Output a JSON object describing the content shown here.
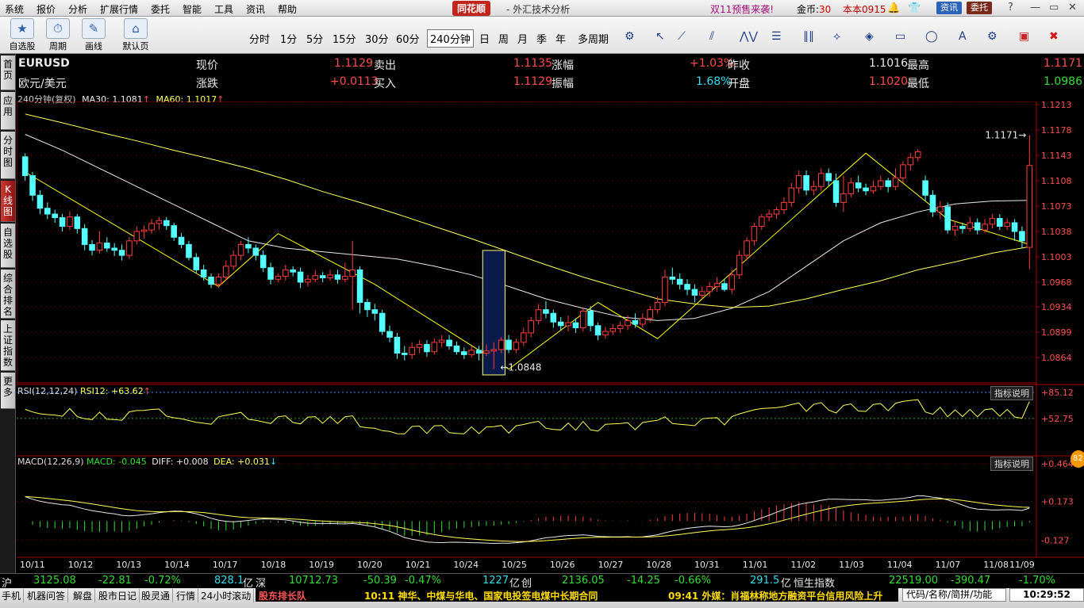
{
  "menu": [
    "系统",
    "报价",
    "分析",
    "扩展行情",
    "委托",
    "智能",
    "工具",
    "资讯",
    "帮助"
  ],
  "brand": "同花顺",
  "app_title": "- 外汇技术分析",
  "promo": "双11预售来袭!",
  "coins_label": "金币:",
  "coins_value": "30",
  "account": "本本0915",
  "header_btns": {
    "news": "资讯",
    "trade": "委托"
  },
  "toolbar": {
    "buttons": [
      "自选股",
      "周期",
      "画线",
      "默认页"
    ],
    "periods": [
      "分时",
      "1分",
      "5分",
      "15分",
      "30分",
      "60分",
      "240分钟",
      "日",
      "周",
      "月",
      "季",
      "年",
      "多周期"
    ],
    "active_period": "240分钟"
  },
  "left_tabs": [
    "首页",
    "应用",
    "分时图",
    "K线图",
    "自选股",
    "综合排名",
    "上证指数",
    "更多"
  ],
  "quote": {
    "symbol": "EURUSD",
    "name": "欧元/美元",
    "labels": {
      "now": "现价",
      "change": "涨跌",
      "sell": "卖出",
      "buy": "买入",
      "pct": "涨幅",
      "amp": "振幅",
      "prev": "昨收",
      "open": "开盘",
      "high": "最高",
      "low": "最低"
    },
    "now": "1.1129",
    "change": "+0.0113",
    "sell": "1.1135",
    "buy": "1.1129",
    "pct": "+1.03%",
    "amp": "1.68%",
    "prev": "1.1016",
    "open": "1.1020",
    "high": "1.1171",
    "low": "1.0986"
  },
  "ma_legend": {
    "period": "240分钟(复权)",
    "ma30_label": "MA30:",
    "ma30": "1.1081",
    "ma60_label": "MA60:",
    "ma60": "1.1017"
  },
  "chart_data": {
    "type": "candlestick",
    "price_axis": [
      "1.1213",
      "1.1178",
      "1.1143",
      "1.1108",
      "1.1073",
      "1.1038",
      "1.1003",
      "1.0968",
      "1.0934",
      "1.0899",
      "1.0864"
    ],
    "ylim": [
      1.0829,
      1.1213
    ],
    "dates": [
      "10/11",
      "10/12",
      "10/13",
      "10/14",
      "10/17",
      "10/18",
      "10/19",
      "10/20",
      "10/21",
      "10/24",
      "10/25",
      "10/26",
      "10/27",
      "10/28",
      "10/31",
      "11/01",
      "11/02",
      "11/03",
      "11/04",
      "11/07",
      "11/08",
      "11/09"
    ],
    "annotations": {
      "low_label": "1.0848",
      "high_label": "1.1171"
    },
    "candles": [
      {
        "o": 1.1141,
        "c": 1.1115,
        "h": 1.1146,
        "l": 1.1108
      },
      {
        "o": 1.1115,
        "c": 1.1088,
        "h": 1.112,
        "l": 1.108
      },
      {
        "o": 1.1088,
        "c": 1.107,
        "h": 1.1095,
        "l": 1.1062
      },
      {
        "o": 1.107,
        "c": 1.1062,
        "h": 1.1078,
        "l": 1.1055
      },
      {
        "o": 1.1062,
        "c": 1.1057,
        "h": 1.1068,
        "l": 1.105
      },
      {
        "o": 1.1057,
        "c": 1.1045,
        "h": 1.1062,
        "l": 1.1038
      },
      {
        "o": 1.1045,
        "c": 1.1058,
        "h": 1.1066,
        "l": 1.104
      },
      {
        "o": 1.1058,
        "c": 1.1042,
        "h": 1.1062,
        "l": 1.1035
      },
      {
        "o": 1.1042,
        "c": 1.102,
        "h": 1.1048,
        "l": 1.1012
      },
      {
        "o": 1.102,
        "c": 1.1012,
        "h": 1.1026,
        "l": 1.1005
      },
      {
        "o": 1.1012,
        "c": 1.1022,
        "h": 1.1038,
        "l": 1.1008
      },
      {
        "o": 1.1022,
        "c": 1.1015,
        "h": 1.103,
        "l": 1.101
      },
      {
        "o": 1.1015,
        "c": 1.1012,
        "h": 1.1022,
        "l": 1.1004
      },
      {
        "o": 1.1012,
        "c": 1.1005,
        "h": 1.102,
        "l": 1.0998
      },
      {
        "o": 1.1005,
        "c": 1.1025,
        "h": 1.103,
        "l": 1.1
      },
      {
        "o": 1.1025,
        "c": 1.1038,
        "h": 1.1045,
        "l": 1.102
      },
      {
        "o": 1.1038,
        "c": 1.104,
        "h": 1.1046,
        "l": 1.1028
      },
      {
        "o": 1.104,
        "c": 1.1049,
        "h": 1.1055,
        "l": 1.1035
      },
      {
        "o": 1.1049,
        "c": 1.1053,
        "h": 1.1058,
        "l": 1.104
      },
      {
        "o": 1.1053,
        "c": 1.1046,
        "h": 1.1058,
        "l": 1.104
      },
      {
        "o": 1.1046,
        "c": 1.103,
        "h": 1.105,
        "l": 1.1025
      },
      {
        "o": 1.103,
        "c": 1.102,
        "h": 1.1036,
        "l": 1.1015
      },
      {
        "o": 1.102,
        "c": 1.1002,
        "h": 1.1025,
        "l": 1.0998
      },
      {
        "o": 1.1002,
        "c": 1.0985,
        "h": 1.1008,
        "l": 1.098
      },
      {
        "o": 1.0985,
        "c": 1.0975,
        "h": 1.0992,
        "l": 1.097
      },
      {
        "o": 1.0975,
        "c": 1.0965,
        "h": 1.098,
        "l": 1.096
      },
      {
        "o": 1.0965,
        "c": 1.0975,
        "h": 1.098,
        "l": 1.096
      },
      {
        "o": 1.0975,
        "c": 1.099,
        "h": 1.0998,
        "l": 1.097
      },
      {
        "o": 1.099,
        "c": 1.1005,
        "h": 1.1012,
        "l": 1.0985
      },
      {
        "o": 1.1005,
        "c": 1.102,
        "h": 1.1025,
        "l": 1.0998
      },
      {
        "o": 1.102,
        "c": 1.1015,
        "h": 1.103,
        "l": 1.1008
      },
      {
        "o": 1.1015,
        "c": 1.1005,
        "h": 1.102,
        "l": 1.0998
      },
      {
        "o": 1.1005,
        "c": 1.0988,
        "h": 1.1012,
        "l": 1.0982
      },
      {
        "o": 1.0988,
        "c": 1.0972,
        "h": 1.0995,
        "l": 1.0965
      },
      {
        "o": 1.0972,
        "c": 1.0976,
        "h": 1.098,
        "l": 1.0968
      },
      {
        "o": 1.0976,
        "c": 1.0985,
        "h": 1.0992,
        "l": 1.097
      },
      {
        "o": 1.0985,
        "c": 1.0982,
        "h": 1.099,
        "l": 1.0976
      },
      {
        "o": 1.0982,
        "c": 1.0968,
        "h": 1.0988,
        "l": 1.096
      },
      {
        "o": 1.0968,
        "c": 1.0972,
        "h": 1.0978,
        "l": 1.0962
      },
      {
        "o": 1.0972,
        "c": 1.0977,
        "h": 1.0985,
        "l": 1.0968
      },
      {
        "o": 1.0977,
        "c": 1.0974,
        "h": 1.0982,
        "l": 1.0968
      },
      {
        "o": 1.0974,
        "c": 1.0978,
        "h": 1.0985,
        "l": 1.097
      },
      {
        "o": 1.0978,
        "c": 1.0972,
        "h": 1.0985,
        "l": 1.0966
      },
      {
        "o": 1.0972,
        "c": 1.0976,
        "h": 1.0995,
        "l": 1.0968
      },
      {
        "o": 1.0976,
        "c": 1.0985,
        "h": 1.1025,
        "l": 1.093
      },
      {
        "o": 1.0985,
        "c": 1.094,
        "h": 1.099,
        "l": 1.0925
      },
      {
        "o": 1.094,
        "c": 1.093,
        "h": 1.0945,
        "l": 1.092
      },
      {
        "o": 1.093,
        "c": 1.0925,
        "h": 1.0938,
        "l": 1.0915
      },
      {
        "o": 1.0925,
        "c": 1.09,
        "h": 1.093,
        "l": 1.0895
      },
      {
        "o": 1.09,
        "c": 1.0892,
        "h": 1.0908,
        "l": 1.0885
      },
      {
        "o": 1.0892,
        "c": 1.087,
        "h": 1.0898,
        "l": 1.0862
      },
      {
        "o": 1.087,
        "c": 1.0868,
        "h": 1.088,
        "l": 1.086
      },
      {
        "o": 1.0868,
        "c": 1.0878,
        "h": 1.0885,
        "l": 1.0862
      },
      {
        "o": 1.0878,
        "c": 1.0882,
        "h": 1.0888,
        "l": 1.087
      },
      {
        "o": 1.0882,
        "c": 1.0872,
        "h": 1.0888,
        "l": 1.0865
      },
      {
        "o": 1.0872,
        "c": 1.0885,
        "h": 1.089,
        "l": 1.0868
      },
      {
        "o": 1.0885,
        "c": 1.0888,
        "h": 1.0895,
        "l": 1.0878
      },
      {
        "o": 1.0888,
        "c": 1.088,
        "h": 1.0895,
        "l": 1.0875
      },
      {
        "o": 1.088,
        "c": 1.0872,
        "h": 1.0886,
        "l": 1.0868
      },
      {
        "o": 1.0872,
        "c": 1.0868,
        "h": 1.0878,
        "l": 1.0862
      },
      {
        "o": 1.0868,
        "c": 1.0874,
        "h": 1.088,
        "l": 1.0864
      },
      {
        "o": 1.0874,
        "c": 1.087,
        "h": 1.088,
        "l": 1.086
      },
      {
        "o": 1.087,
        "c": 1.0873,
        "h": 1.0882,
        "l": 1.0866
      },
      {
        "o": 1.0873,
        "c": 1.0875,
        "h": 1.0885,
        "l": 1.0848
      },
      {
        "o": 1.0875,
        "c": 1.0888,
        "h": 1.0892,
        "l": 1.087
      },
      {
        "o": 1.0888,
        "c": 1.0875,
        "h": 1.0895,
        "l": 1.087
      },
      {
        "o": 1.0875,
        "c": 1.0885,
        "h": 1.089,
        "l": 1.087
      },
      {
        "o": 1.0885,
        "c": 1.0898,
        "h": 1.0905,
        "l": 1.088
      },
      {
        "o": 1.0898,
        "c": 1.0915,
        "h": 1.092,
        "l": 1.0892
      },
      {
        "o": 1.0915,
        "c": 1.093,
        "h": 1.0938,
        "l": 1.091
      },
      {
        "o": 1.093,
        "c": 1.0925,
        "h": 1.0942,
        "l": 1.0918
      },
      {
        "o": 1.0925,
        "c": 1.0913,
        "h": 1.093,
        "l": 1.0905
      },
      {
        "o": 1.0913,
        "c": 1.0908,
        "h": 1.092,
        "l": 1.0902
      },
      {
        "o": 1.0908,
        "c": 1.0912,
        "h": 1.0922,
        "l": 1.09
      },
      {
        "o": 1.0912,
        "c": 1.0905,
        "h": 1.0918,
        "l": 1.0898
      },
      {
        "o": 1.0905,
        "c": 1.0928,
        "h": 1.0932,
        "l": 1.09
      },
      {
        "o": 1.0928,
        "c": 1.0908,
        "h": 1.0935,
        "l": 1.09
      },
      {
        "o": 1.0908,
        "c": 1.0895,
        "h": 1.0912,
        "l": 1.0888
      },
      {
        "o": 1.0895,
        "c": 1.09,
        "h": 1.0906,
        "l": 1.089
      },
      {
        "o": 1.09,
        "c": 1.0904,
        "h": 1.091,
        "l": 1.0895
      },
      {
        "o": 1.0904,
        "c": 1.0908,
        "h": 1.0914,
        "l": 1.0898
      },
      {
        "o": 1.0908,
        "c": 1.0915,
        "h": 1.0922,
        "l": 1.0902
      },
      {
        "o": 1.0915,
        "c": 1.091,
        "h": 1.0925,
        "l": 1.0905
      },
      {
        "o": 1.091,
        "c": 1.0918,
        "h": 1.0925,
        "l": 1.0905
      },
      {
        "o": 1.0918,
        "c": 1.093,
        "h": 1.0935,
        "l": 1.0912
      },
      {
        "o": 1.093,
        "c": 1.094,
        "h": 1.0948,
        "l": 1.0925
      },
      {
        "o": 1.094,
        "c": 1.0975,
        "h": 1.0985,
        "l": 1.0935
      },
      {
        "o": 1.0975,
        "c": 1.0972,
        "h": 1.0988,
        "l": 1.0965
      },
      {
        "o": 1.0972,
        "c": 1.0965,
        "h": 1.098,
        "l": 1.0958
      },
      {
        "o": 1.0965,
        "c": 1.0958,
        "h": 1.0972,
        "l": 1.095
      },
      {
        "o": 1.0958,
        "c": 1.095,
        "h": 1.0965,
        "l": 1.094
      },
      {
        "o": 1.095,
        "c": 1.0955,
        "h": 1.0962,
        "l": 1.0945
      },
      {
        "o": 1.0955,
        "c": 1.0962,
        "h": 1.0968,
        "l": 1.0948
      },
      {
        "o": 1.0962,
        "c": 1.0966,
        "h": 1.0975,
        "l": 1.0955
      },
      {
        "o": 1.0966,
        "c": 1.0958,
        "h": 1.0972,
        "l": 1.0955
      },
      {
        "o": 1.0958,
        "c": 1.0978,
        "h": 1.0985,
        "l": 1.0952
      },
      {
        "o": 1.0978,
        "c": 1.1005,
        "h": 1.1012,
        "l": 1.0972
      },
      {
        "o": 1.1005,
        "c": 1.1025,
        "h": 1.103,
        "l": 1.0998
      },
      {
        "o": 1.1025,
        "c": 1.1045,
        "h": 1.105,
        "l": 1.1018
      },
      {
        "o": 1.1045,
        "c": 1.1058,
        "h": 1.1062,
        "l": 1.104
      },
      {
        "o": 1.1058,
        "c": 1.1062,
        "h": 1.1068,
        "l": 1.1052
      },
      {
        "o": 1.1062,
        "c": 1.1068,
        "h": 1.1072,
        "l": 1.1055
      },
      {
        "o": 1.1068,
        "c": 1.1078,
        "h": 1.1085,
        "l": 1.1062
      },
      {
        "o": 1.1078,
        "c": 1.1098,
        "h": 1.1105,
        "l": 1.1072
      },
      {
        "o": 1.1098,
        "c": 1.1115,
        "h": 1.1122,
        "l": 1.109
      },
      {
        "o": 1.1115,
        "c": 1.1095,
        "h": 1.1122,
        "l": 1.1088
      },
      {
        "o": 1.1095,
        "c": 1.11,
        "h": 1.1108,
        "l": 1.1088
      },
      {
        "o": 1.11,
        "c": 1.1118,
        "h": 1.1125,
        "l": 1.1094
      },
      {
        "o": 1.1118,
        "c": 1.1108,
        "h": 1.1125,
        "l": 1.11
      },
      {
        "o": 1.1108,
        "c": 1.1078,
        "h": 1.1118,
        "l": 1.1072
      },
      {
        "o": 1.1078,
        "c": 1.109,
        "h": 1.1115,
        "l": 1.1065
      },
      {
        "o": 1.109,
        "c": 1.1105,
        "h": 1.1112,
        "l": 1.1085
      },
      {
        "o": 1.1105,
        "c": 1.1098,
        "h": 1.1115,
        "l": 1.1092
      },
      {
        "o": 1.1098,
        "c": 1.1094,
        "h": 1.1104,
        "l": 1.1088
      },
      {
        "o": 1.1094,
        "c": 1.11,
        "h": 1.1108,
        "l": 1.109
      },
      {
        "o": 1.11,
        "c": 1.1108,
        "h": 1.1115,
        "l": 1.1095
      },
      {
        "o": 1.1108,
        "c": 1.11,
        "h": 1.1112,
        "l": 1.1092
      },
      {
        "o": 1.11,
        "c": 1.1112,
        "h": 1.1125,
        "l": 1.1095
      },
      {
        "o": 1.1112,
        "c": 1.113,
        "h": 1.1135,
        "l": 1.1105
      },
      {
        "o": 1.113,
        "c": 1.114,
        "h": 1.1146,
        "l": 1.1122
      },
      {
        "o": 1.114,
        "c": 1.1148,
        "h": 1.1152,
        "l": 1.1135
      },
      {
        "o": 1.1108,
        "c": 1.1088,
        "h": 1.1115,
        "l": 1.108
      },
      {
        "o": 1.1088,
        "c": 1.1065,
        "h": 1.1095,
        "l": 1.1058
      },
      {
        "o": 1.1065,
        "c": 1.1072,
        "h": 1.108,
        "l": 1.1055
      },
      {
        "o": 1.1072,
        "c": 1.104,
        "h": 1.1078,
        "l": 1.1035
      },
      {
        "o": 1.104,
        "c": 1.1045,
        "h": 1.1052,
        "l": 1.1032
      },
      {
        "o": 1.1045,
        "c": 1.1042,
        "h": 1.105,
        "l": 1.1035
      },
      {
        "o": 1.1042,
        "c": 1.105,
        "h": 1.1058,
        "l": 1.1038
      },
      {
        "o": 1.105,
        "c": 1.104,
        "h": 1.1056,
        "l": 1.1034
      },
      {
        "o": 1.104,
        "c": 1.1048,
        "h": 1.1055,
        "l": 1.1036
      },
      {
        "o": 1.1048,
        "c": 1.1056,
        "h": 1.1062,
        "l": 1.1042
      },
      {
        "o": 1.1056,
        "c": 1.1045,
        "h": 1.1062,
        "l": 1.104
      },
      {
        "o": 1.1045,
        "c": 1.105,
        "h": 1.1056,
        "l": 1.104
      },
      {
        "o": 1.105,
        "c": 1.1038,
        "h": 1.1055,
        "l": 1.1025
      },
      {
        "o": 1.1038,
        "c": 1.1025,
        "h": 1.1045,
        "l": 1.1015
      },
      {
        "o": 1.1016,
        "c": 1.1129,
        "h": 1.1171,
        "l": 1.0986
      }
    ],
    "ma30": [
      1.1172,
      1.115,
      1.1125,
      1.11,
      1.1075,
      1.105,
      1.1025,
      1.1015,
      1.101,
      1.1005,
      1.1,
      1.099,
      1.0978,
      1.0962,
      1.0945,
      1.0932,
      1.092,
      1.0915,
      1.0918,
      1.0932,
      1.0955,
      1.099,
      1.1025,
      1.105,
      1.1065,
      1.1076,
      1.108,
      1.1081
    ],
    "ma60": [
      1.12,
      1.1188,
      1.1175,
      1.1163,
      1.115,
      1.1138,
      1.1125,
      1.111,
      1.1093,
      1.1078,
      1.1062,
      1.1045,
      1.1028,
      1.101,
      1.0992,
      1.0975,
      1.096,
      1.0945,
      1.0938,
      1.0933,
      1.0935,
      1.0945,
      1.0958,
      1.097,
      1.0985,
      1.0996,
      1.1008,
      1.1017
    ],
    "rsi": {
      "label": "RSI(12,12,24)",
      "rsi12_label": "RSI12:",
      "rsi12": "+63.62",
      "ticks": [
        "+85.12",
        "+52.75"
      ]
    },
    "macd": {
      "label": "MACD(12,26,9)",
      "macd_label": "MACD:",
      "macd": "-0.045",
      "diff_label": "DIFF:",
      "diff": "+0.008",
      "dea_label": "DEA:",
      "dea": "+0.031",
      "ticks": [
        "+0.464",
        "+0.173",
        "-0.127"
      ]
    },
    "hint": "指标说明"
  },
  "status": {
    "sh_label": "沪",
    "sh_index": "3125.08",
    "sh_chg": "-22.81",
    "sh_pct": "-0.72%",
    "sh_amt": "828.1",
    "yi": "亿",
    "sz_label": "深",
    "sz_index": "10712.73",
    "sz_chg": "-50.39",
    "sz_pct": "-0.47%",
    "sz_amt": "1227",
    "cy_label": "创",
    "cy_index": "2136.05",
    "cy_chg": "-14.25",
    "cy_pct": "-0.66%",
    "cy_amt": "291.5",
    "hs_label": "恒生指数",
    "hs_index": "22519.00",
    "hs_chg": "-390.47",
    "hs_pct": "-1.70%"
  },
  "bottom_tabs": [
    "手机",
    "机器问答",
    "解盘",
    "股市日记",
    "股灵通",
    "行情",
    "24小时滚动"
  ],
  "news": [
    {
      "text": "股东排长队",
      "color": "#ff5555"
    },
    {
      "text": "10:11 神华、中煤与华电、国家电投签电煤中长期合同",
      "color": "#ffdd00"
    },
    {
      "text": "09:41 外媒：肖福林称地方融资平台信用风险上升",
      "color": "#ffdd00"
    }
  ],
  "code_placeholder": "代码/名称/简拼/功能",
  "clock": "10:29:52",
  "badge": "82"
}
